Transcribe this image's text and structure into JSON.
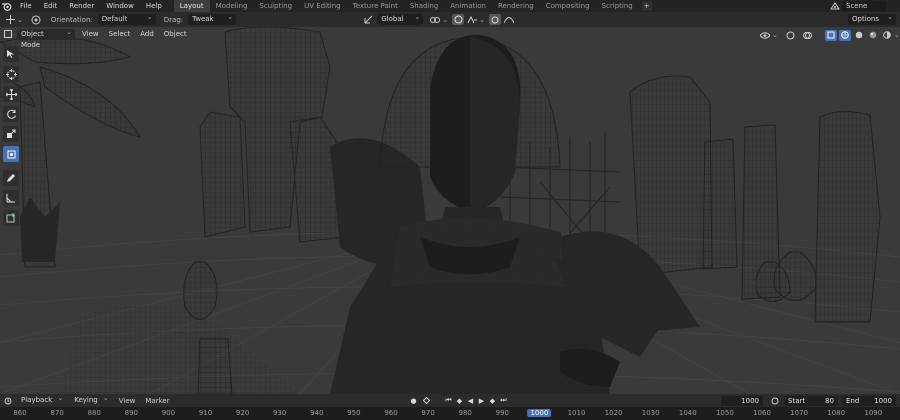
{
  "menubar": {
    "items": [
      "File",
      "Edit",
      "Render",
      "Window",
      "Help"
    ]
  },
  "workspaces": {
    "tabs": [
      "Layout",
      "Modeling",
      "Sculpting",
      "UV Editing",
      "Texture Paint",
      "Shading",
      "Animation",
      "Rendering",
      "Compositing",
      "Scripting"
    ],
    "active": "Layout",
    "add_label": "+"
  },
  "scene": {
    "name": "Scene"
  },
  "tool_settings": {
    "orientation_label": "Orientation:",
    "orientation_value": "Default",
    "drag_label": "Drag:",
    "drag_value": "Tweak",
    "transform_value": "Global",
    "options_label": "Options"
  },
  "viewport_header": {
    "mode": "Object Mode",
    "menus": [
      "View",
      "Select",
      "Add",
      "Object"
    ]
  },
  "timeline": {
    "menus": [
      "Playback",
      "Keying",
      "View",
      "Marker"
    ],
    "current_frame": "1000",
    "start_label": "Start",
    "start_value": "80",
    "end_label": "End",
    "end_value": "1000"
  },
  "ruler": {
    "ticks": [
      "860",
      "870",
      "880",
      "890",
      "900",
      "910",
      "920",
      "930",
      "940",
      "950",
      "960",
      "970",
      "980",
      "990",
      "1000",
      "1010",
      "1020",
      "1030",
      "1040",
      "1050",
      "1060",
      "1070",
      "1080",
      "1090"
    ],
    "current": "1000"
  },
  "colors": {
    "accent": "#4772b3",
    "header": "#232323",
    "panel": "#2b2b2b",
    "viewport": "#3a3a3a",
    "wire": "#1e1e1e"
  }
}
